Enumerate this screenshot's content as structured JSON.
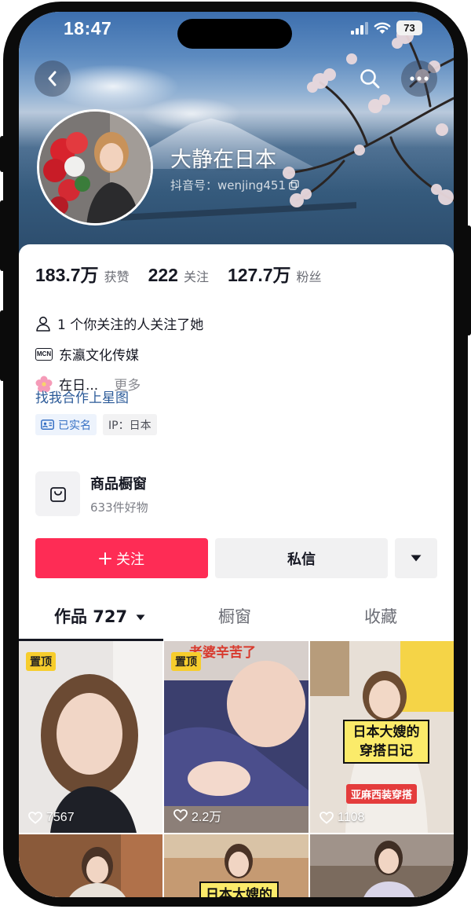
{
  "status_bar": {
    "time": "18:47",
    "battery": "73"
  },
  "profile": {
    "nickname": "大静在日本",
    "douyin_id": "抖音号：wenjing451"
  },
  "stats": [
    {
      "value": "183.7万",
      "label": "获赞"
    },
    {
      "value": "222",
      "label": "关注"
    },
    {
      "value": "127.7万",
      "label": "粉丝"
    }
  ],
  "info": {
    "mutual": "1 个你关注的人关注了她",
    "mcn_badge": "MCN",
    "mcn": "东瀛文化传媒",
    "bio": "在日...",
    "more": "更多",
    "link": "找我合作上星图",
    "verified": "已实名",
    "ip": "IP：日本"
  },
  "shop": {
    "title": "商品橱窗",
    "subtitle": "633件好物"
  },
  "actions": {
    "follow": "关注",
    "message": "私信"
  },
  "tabs": [
    {
      "label": "作品 727",
      "active": true
    },
    {
      "label": "橱窗",
      "active": false
    },
    {
      "label": "收藏",
      "active": false
    }
  ],
  "videos": [
    {
      "pinned": "置顶",
      "likes": "7567",
      "caption": ""
    },
    {
      "pinned": "置顶",
      "likes": "2.2万",
      "caption": "老婆辛苦了"
    },
    {
      "pinned": "",
      "likes": "1108",
      "caption": "日本大嫂的穿搭日记",
      "sub_caption": "亚麻西装穿搭"
    },
    {
      "caption": ""
    },
    {
      "caption": "日本大嫂的"
    },
    {
      "caption": ""
    }
  ],
  "colors": {
    "accent": "#fe2c55",
    "link": "#2b5a98",
    "pin": "#f7cd2c"
  }
}
